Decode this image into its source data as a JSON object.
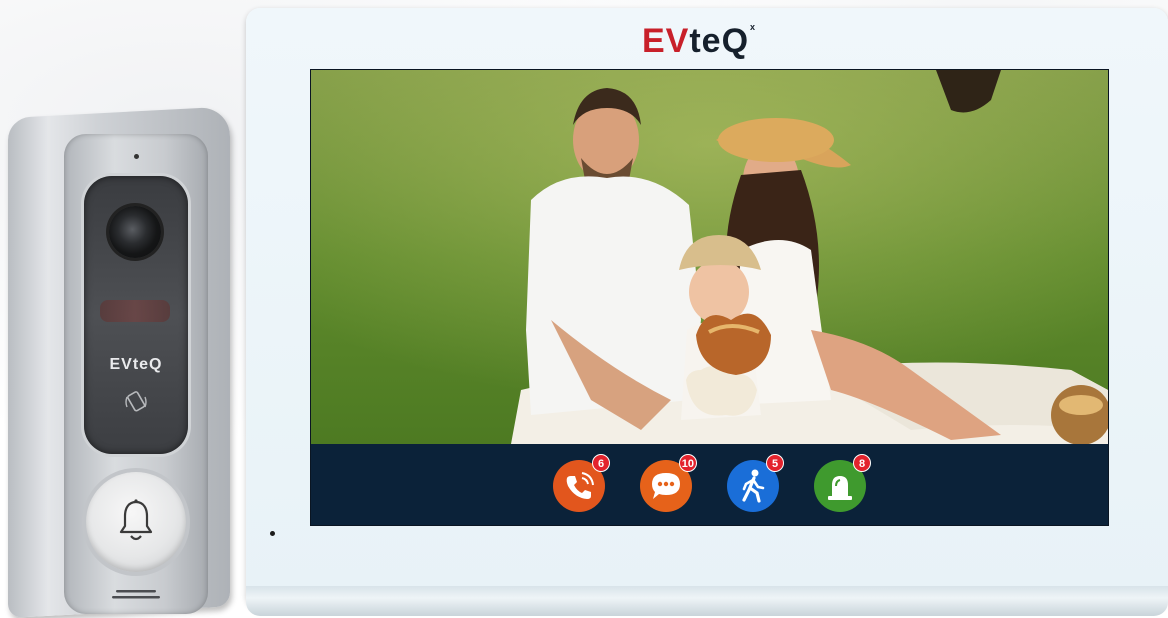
{
  "monitor": {
    "brand": {
      "ev": "EV",
      "teq": "teQ",
      "mark": "x"
    }
  },
  "doorbell": {
    "logo": "EVteQ"
  },
  "dock": {
    "items": [
      {
        "name": "call-log",
        "icon": "phone-call-icon",
        "color": "#e2561d",
        "badge": "6"
      },
      {
        "name": "messages",
        "icon": "chat-bubble-icon",
        "color": "#e6621a",
        "badge": "10"
      },
      {
        "name": "motion",
        "icon": "walking-person-icon",
        "color": "#1a6ed8",
        "badge": "5"
      },
      {
        "name": "alarm",
        "icon": "siren-icon",
        "color": "#3f9a2e",
        "badge": "8"
      }
    ]
  }
}
